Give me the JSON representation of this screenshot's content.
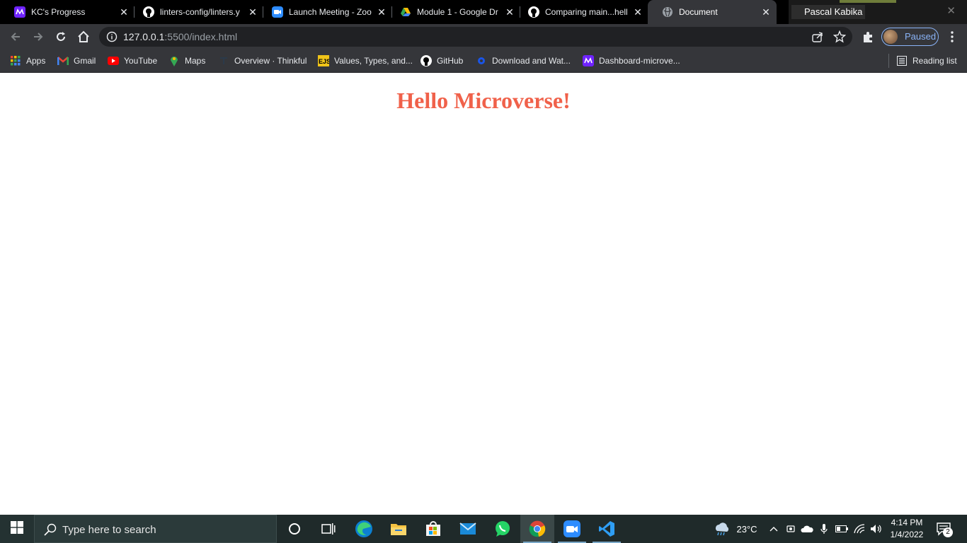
{
  "tabs": [
    {
      "title": "KC's Progress",
      "icon": "microverse-icon"
    },
    {
      "title": "linters-config/linters.y",
      "icon": "github-icon"
    },
    {
      "title": "Launch Meeting - Zoo",
      "icon": "zoom-icon"
    },
    {
      "title": "Module 1 - Google Dr",
      "icon": "google-drive-icon"
    },
    {
      "title": "Comparing main...hell",
      "icon": "github-icon"
    },
    {
      "title": "Document",
      "icon": "globe-icon",
      "active": true
    }
  ],
  "zoom_overlay": {
    "name": "Pascal Kabika"
  },
  "omnibox": {
    "host": "127.0.0.1",
    "path": ":5500/index.html"
  },
  "profile": {
    "status": "Paused"
  },
  "bookmarks": [
    {
      "label": "Apps",
      "icon": "apps-grid-icon"
    },
    {
      "label": "Gmail",
      "icon": "gmail-icon"
    },
    {
      "label": "YouTube",
      "icon": "youtube-icon"
    },
    {
      "label": "Maps",
      "icon": "maps-icon"
    },
    {
      "label": "Overview · Thinkful",
      "icon": "thinkful-icon"
    },
    {
      "label": "Values, Types, and...",
      "icon": "eloquent-js-icon"
    },
    {
      "label": "GitHub",
      "icon": "github-icon"
    },
    {
      "label": "Download and Wat...",
      "icon": "download-icon"
    },
    {
      "label": "Dashboard-microve...",
      "icon": "microverse-icon"
    }
  ],
  "reading_list": "Reading list",
  "page": {
    "heading": "Hello Microverse!",
    "heading_color": "#f0614a"
  },
  "taskbar": {
    "search_placeholder": "Type here to search",
    "weather": "23°C",
    "time": "4:14 PM",
    "date": "1/4/2022",
    "notifications": "2"
  },
  "colors": {
    "accent": "#8ab4f8",
    "chrome_bg": "#35363a"
  }
}
